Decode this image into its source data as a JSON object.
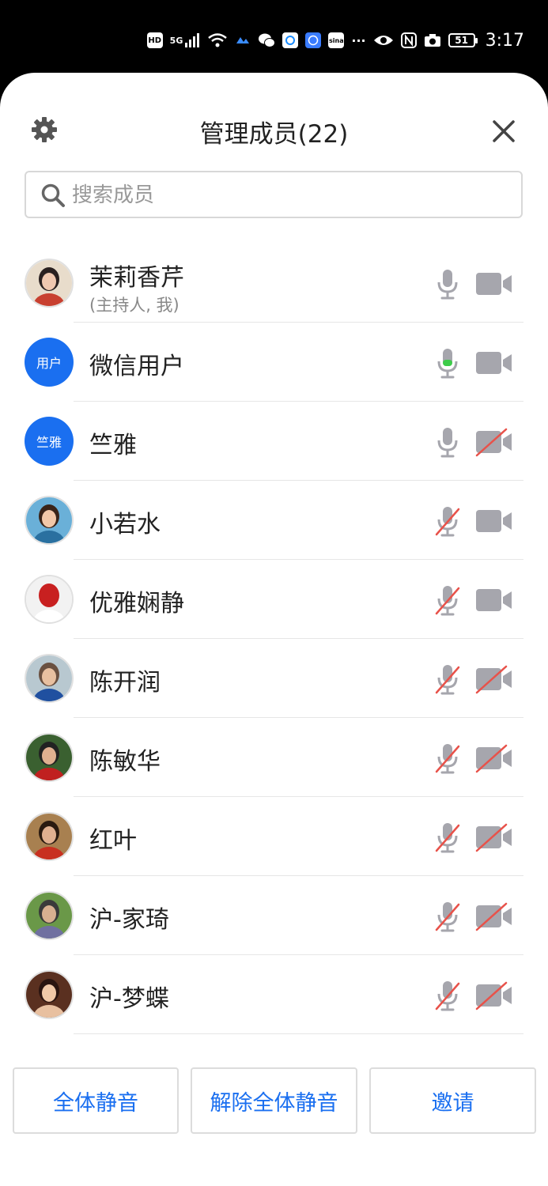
{
  "status_bar": {
    "hd": "HD",
    "network": "5G",
    "time": "3:17",
    "battery": "51",
    "more": "···"
  },
  "header": {
    "title": "管理成员(22)"
  },
  "search": {
    "placeholder": "搜索成员"
  },
  "members": [
    {
      "name": "茉莉香芹",
      "sub": "(主持人, 我)",
      "avatar": "photo",
      "mic": "on",
      "camera": "on"
    },
    {
      "name": "微信用户",
      "sub": "",
      "avatar_text": "用户",
      "mic": "speaking",
      "camera": "on"
    },
    {
      "name": "竺雅",
      "sub": "",
      "avatar_text": "竺雅",
      "mic": "on",
      "camera": "off"
    },
    {
      "name": "小若水",
      "sub": "",
      "avatar": "photo",
      "mic": "off",
      "camera": "on"
    },
    {
      "name": "优雅娴静",
      "sub": "",
      "avatar": "photo",
      "mic": "off",
      "camera": "on"
    },
    {
      "name": "陈开润",
      "sub": "",
      "avatar": "photo",
      "mic": "off",
      "camera": "off"
    },
    {
      "name": "陈敏华",
      "sub": "",
      "avatar": "photo",
      "mic": "off",
      "camera": "off"
    },
    {
      "name": "红叶",
      "sub": "",
      "avatar": "photo",
      "mic": "off",
      "camera": "off"
    },
    {
      "name": "沪-家琦",
      "sub": "",
      "avatar": "photo",
      "mic": "off",
      "camera": "off"
    },
    {
      "name": "沪-梦蝶",
      "sub": "",
      "avatar": "photo",
      "mic": "off",
      "camera": "off"
    }
  ],
  "footer": {
    "mute_all": "全体静音",
    "unmute_all": "解除全体静音",
    "invite": "邀请"
  },
  "colors": {
    "accent": "#1a6ff0",
    "icon_gray": "#a6a6ad",
    "muted_red": "#e8524a",
    "speaking_green": "#3dcc4a"
  }
}
